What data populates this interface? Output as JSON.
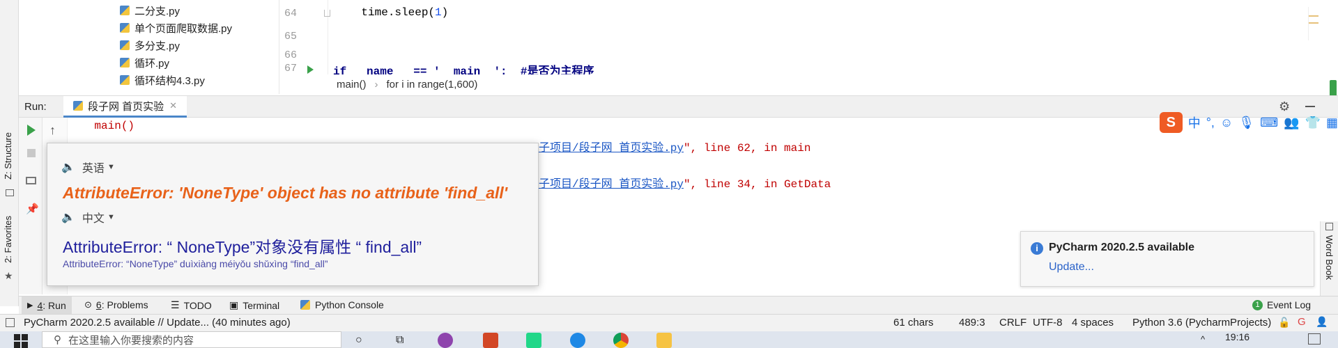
{
  "tool_windows": {
    "structure": "Z: Structure",
    "favorites": "2: Favorites",
    "word_book": "Word Book"
  },
  "project_files": [
    "二分支.py",
    "单个页面爬取数据.py",
    "多分支.py",
    "循环.py",
    "循环结构4.3.py"
  ],
  "editor": {
    "lines": [
      {
        "num": "64",
        "code": "    time.sleep(",
        "arg": "1",
        "end": ")"
      },
      {
        "num": "65",
        "code": ""
      },
      {
        "num": "66",
        "code": ""
      },
      {
        "num": "67",
        "code": "if __name__ == '__main__':  #是否为主程序"
      }
    ],
    "breadcrumb": [
      "main()",
      "for i in range(1,600)"
    ]
  },
  "run": {
    "label": "Run:",
    "tab": "段子网 首页实验",
    "console_call": "    main()",
    "link1_tail": "子项目/段子网 首页实验.py",
    "rest1": "\", line 62, in main",
    "link2_tail": "子项目/段子网 首页实验.py",
    "rest2": "\", line 34, in GetData"
  },
  "translate_popup": {
    "lang_en": "英语",
    "error_en": "AttributeError: 'NoneType' object has no attribute 'find_all'",
    "lang_zh": "中文",
    "error_zh": "AttributeError: “ NoneType”对象没有属性 “ find_all”",
    "pinyin": "AttributeError: “NoneType” duìxiàng méiyǒu shǔxìng “find_all”"
  },
  "notification": {
    "title": "PyCharm 2020.2.5 available",
    "action": "Update..."
  },
  "bottom_tabs": [
    {
      "key": "4",
      "label": ": Run"
    },
    {
      "key": "6",
      "label": ": Problems"
    },
    {
      "key": "",
      "label": "TODO"
    },
    {
      "key": "",
      "label": "Terminal"
    },
    {
      "key": "",
      "label": "Python Console"
    }
  ],
  "event_log": "Event Log",
  "status": {
    "message": "PyCharm 2020.2.5 available // Update... (40 minutes ago)",
    "chars": "61 chars",
    "position": "489:3",
    "line_sep": "CRLF",
    "encoding": "UTF-8",
    "indent": "4 spaces",
    "interpreter": "Python 3.6 (PycharmProjects)"
  },
  "taskbar": {
    "search_placeholder": "在这里输入你要搜索的内容",
    "time": "19:16"
  },
  "ime": {
    "mode": "中"
  },
  "colors": {
    "error_orange": "#e8621a",
    "zh_blue": "#1f1f9c",
    "link_blue": "#1a56c4",
    "console_red": "#c00000"
  }
}
